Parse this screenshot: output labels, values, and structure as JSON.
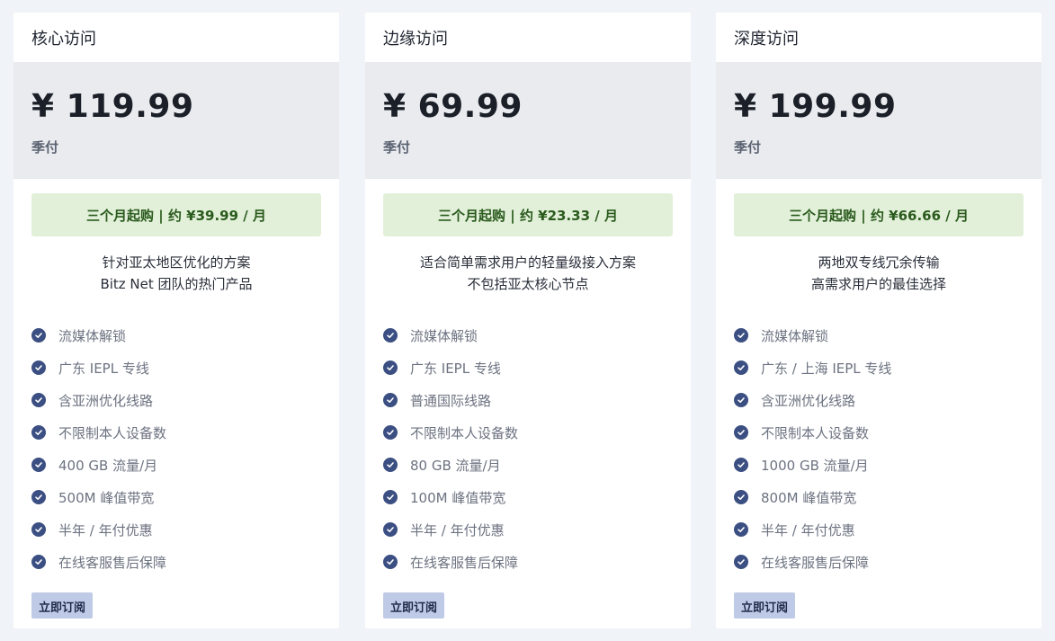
{
  "plans": [
    {
      "title": "核心访问",
      "price": "¥ 119.99",
      "period": "季付",
      "promo": "三个月起购 | 约 ¥39.99 / 月",
      "description": [
        "针对亚太地区优化的方案",
        "Bitz Net 团队的热门产品"
      ],
      "features": [
        "流媒体解锁",
        "广东 IEPL 专线",
        "含亚洲优化线路",
        "不限制本人设备数",
        "400 GB 流量/月",
        "500M 峰值带宽",
        "半年 / 年付优惠",
        "在线客服售后保障"
      ],
      "button": "立即订阅"
    },
    {
      "title": "边缘访问",
      "price": "¥ 69.99",
      "period": "季付",
      "promo": "三个月起购 | 约 ¥23.33 / 月",
      "description": [
        "适合简单需求用户的轻量级接入方案",
        "不包括亚太核心节点"
      ],
      "features": [
        "流媒体解锁",
        "广东 IEPL 专线",
        "普通国际线路",
        "不限制本人设备数",
        "80 GB 流量/月",
        "100M 峰值带宽",
        "半年 / 年付优惠",
        "在线客服售后保障"
      ],
      "button": "立即订阅"
    },
    {
      "title": "深度访问",
      "price": "¥ 199.99",
      "period": "季付",
      "promo": "三个月起购 | 约 ¥66.66 / 月",
      "description": [
        "两地双专线冗余传输",
        "高需求用户的最佳选择"
      ],
      "features": [
        "流媒体解锁",
        "广东 / 上海 IEPL 专线",
        "含亚洲优化线路",
        "不限制本人设备数",
        "1000 GB 流量/月",
        "800M 峰值带宽",
        "半年 / 年付优惠",
        "在线客服售后保障"
      ],
      "button": "立即订阅"
    }
  ]
}
